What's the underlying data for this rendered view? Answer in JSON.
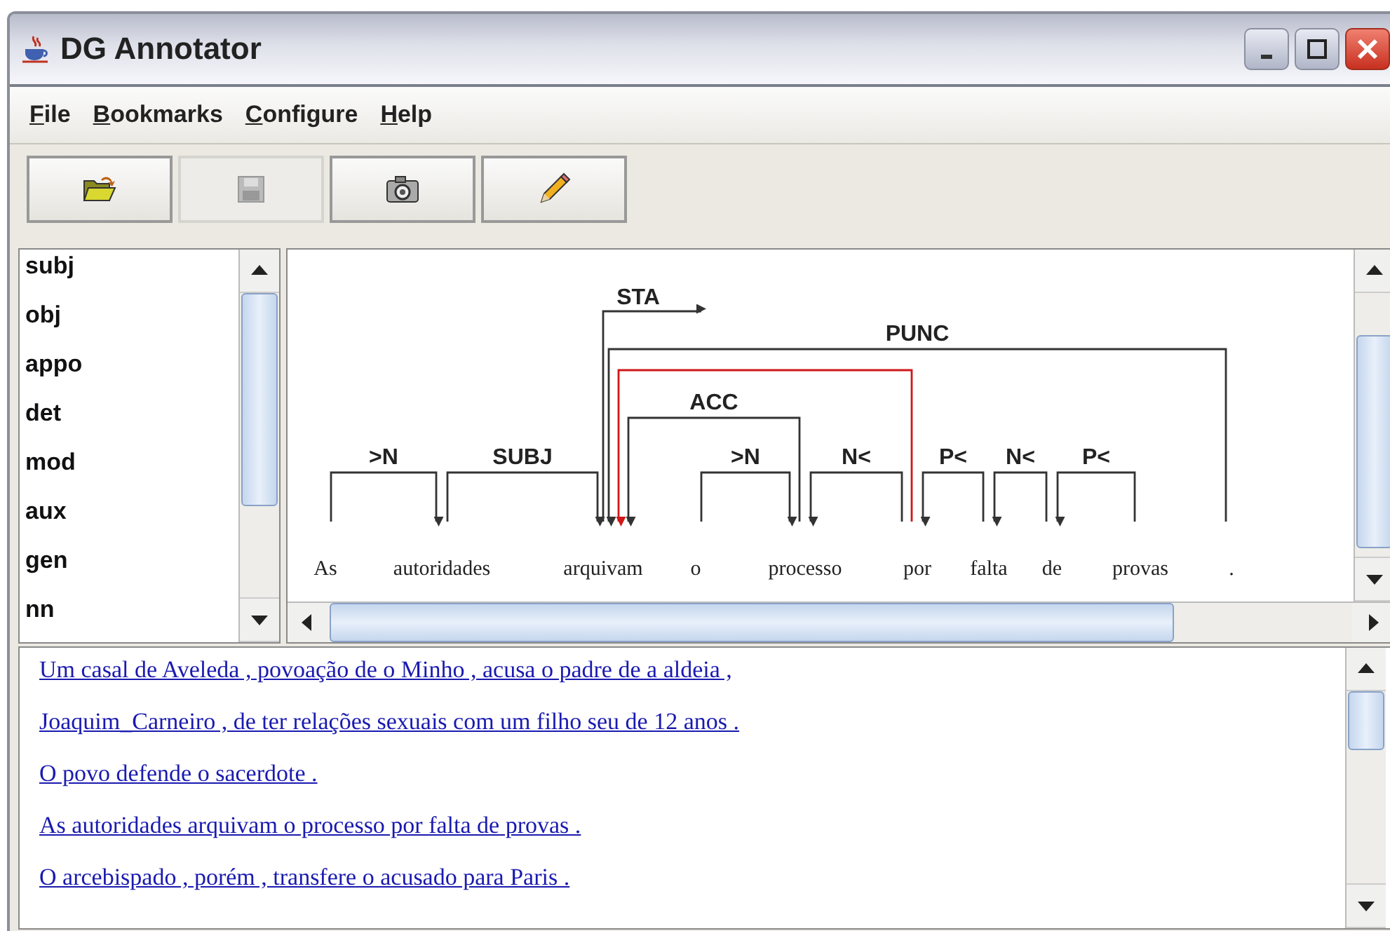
{
  "window": {
    "title": "DG Annotator"
  },
  "menu": [
    "File",
    "Bookmarks",
    "Configure",
    "Help"
  ],
  "toolbar": [
    {
      "kind": "open",
      "disabled": false
    },
    {
      "kind": "save",
      "disabled": true
    },
    {
      "kind": "camera",
      "disabled": false
    },
    {
      "kind": "pencil",
      "disabled": false
    }
  ],
  "relations": [
    "subj",
    "obj",
    "appo",
    "det",
    "mod",
    "aux",
    "gen",
    "nn"
  ],
  "diagram": {
    "tree": {
      "word": "arquivam",
      "relation": "STA",
      "selected": false,
      "children_before": [
        {
          "word": "autoridades",
          "relation": "SUBJ",
          "selected": false,
          "children_before": [
            {
              "word": "As",
              "relation": ">N",
              "selected": false
            }
          ]
        }
      ],
      "children_after": [
        {
          "word": "processo",
          "relation": "ACC",
          "selected": false,
          "children_before": [
            {
              "word": "o",
              "relation": ">N",
              "selected": false
            }
          ],
          "children_after": [
            {
              "word": "por",
              "relation": "N<",
              "selected": false,
              "second_arc_to_grandparent": {
                "selected": true
              },
              "children_after": [
                {
                  "word": "falta",
                  "relation": "P<",
                  "selected": false,
                  "children_after": [
                    {
                      "word": "de",
                      "relation": "N<",
                      "selected": false,
                      "children_after": [
                        {
                          "word": "provas",
                          "relation": "P<",
                          "selected": false
                        }
                      ]
                    }
                  ]
                }
              ]
            }
          ]
        },
        {
          "word": ".",
          "relation": "PUNC",
          "selected": false
        }
      ]
    }
  },
  "sentences": [
    "Um casal de Aveleda , povoação de o Minho , acusa o padre de a aldeia ,",
    "Joaquim_Carneiro , de ter relações sexuais com um filho seu de 12 anos .",
    "O povo defende o sacerdote .",
    "As autoridades arquivam o processo por falta de provas .",
    "O arcebispado , porém , transfere o acusado para Paris ."
  ]
}
